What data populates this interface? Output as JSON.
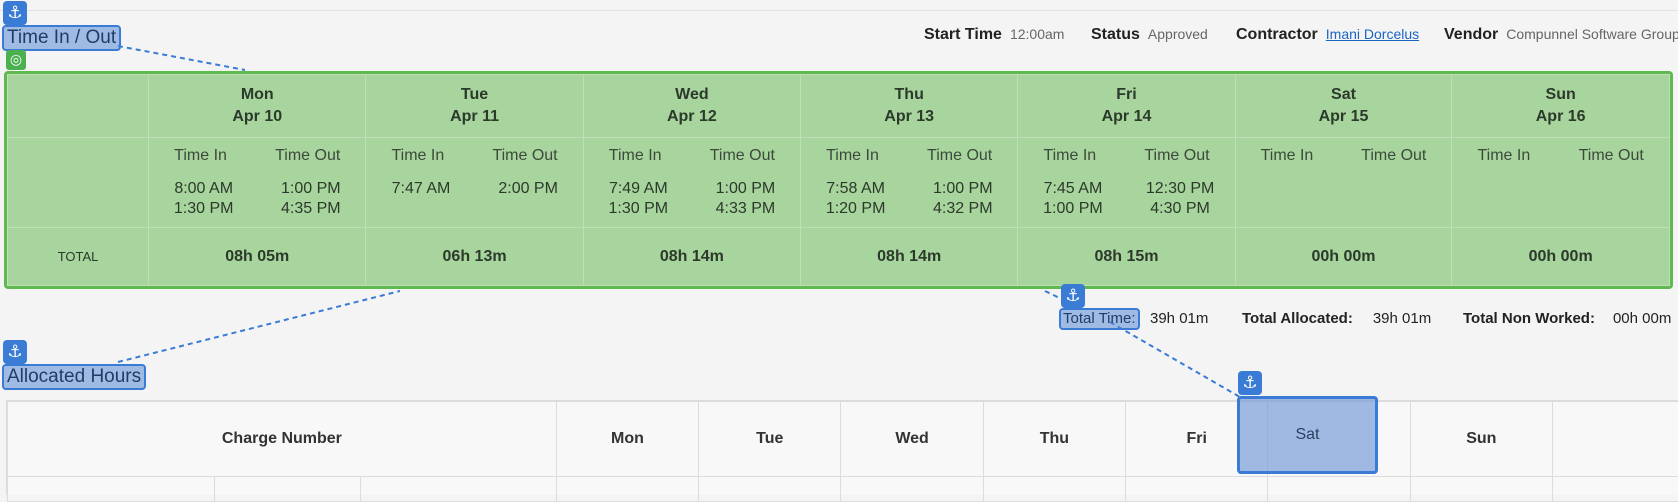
{
  "sections": {
    "time_title": "Time In / Out",
    "allocated_title": "Allocated Hours"
  },
  "meta": {
    "start_time_label": "Start Time",
    "start_time_value": "12:00am",
    "status_label": "Status",
    "status_value": "Approved",
    "contractor_label": "Contractor",
    "contractor_value": "Imani Dorcelus",
    "vendor_label": "Vendor",
    "vendor_value": "Compunnel Software Group"
  },
  "time_table": {
    "time_in_label": "Time In",
    "time_out_label": "Time Out",
    "total_label": "TOTAL",
    "days": [
      {
        "day": "Mon",
        "date": "Apr 10",
        "time_in": [
          "8:00 AM",
          "1:30 PM"
        ],
        "time_out": [
          "1:00 PM",
          "4:35 PM"
        ],
        "total": "08h 05m"
      },
      {
        "day": "Tue",
        "date": "Apr 11",
        "time_in": [
          "7:47 AM"
        ],
        "time_out": [
          "2:00 PM"
        ],
        "total": "06h 13m"
      },
      {
        "day": "Wed",
        "date": "Apr 12",
        "time_in": [
          "7:49 AM",
          "1:30 PM"
        ],
        "time_out": [
          "1:00 PM",
          "4:33 PM"
        ],
        "total": "08h 14m"
      },
      {
        "day": "Thu",
        "date": "Apr 13",
        "time_in": [
          "7:58 AM",
          "1:20 PM"
        ],
        "time_out": [
          "1:00 PM",
          "4:32 PM"
        ],
        "total": "08h 14m"
      },
      {
        "day": "Fri",
        "date": "Apr 14",
        "time_in": [
          "7:45 AM",
          "1:00 PM"
        ],
        "time_out": [
          "12:30 PM",
          "4:30 PM"
        ],
        "total": "08h 15m"
      },
      {
        "day": "Sat",
        "date": "Apr 15",
        "time_in": [],
        "time_out": [],
        "total": "00h 00m"
      },
      {
        "day": "Sun",
        "date": "Apr 16",
        "time_in": [],
        "time_out": [],
        "total": "00h 00m"
      }
    ]
  },
  "totals": {
    "total_time_label": "Total Time:",
    "total_time_value": "39h 01m",
    "total_allocated_label": "Total Allocated:",
    "total_allocated_value": "39h 01m",
    "total_non_worked_label": "Total Non Worked:",
    "total_non_worked_value": "00h 00m"
  },
  "allocated_table": {
    "charge_number_label": "Charge Number",
    "days": [
      "Mon",
      "Tue",
      "Wed",
      "Thu",
      "Fri",
      "Sat",
      "Sun"
    ]
  },
  "icons": {
    "anchor": "anchor-icon",
    "target": "target-icon"
  },
  "colors": {
    "highlight_green": "#a8d49d",
    "highlight_green_border": "#5fb850",
    "highlight_blue": "#3a7bd5",
    "link": "#1a66c2"
  }
}
